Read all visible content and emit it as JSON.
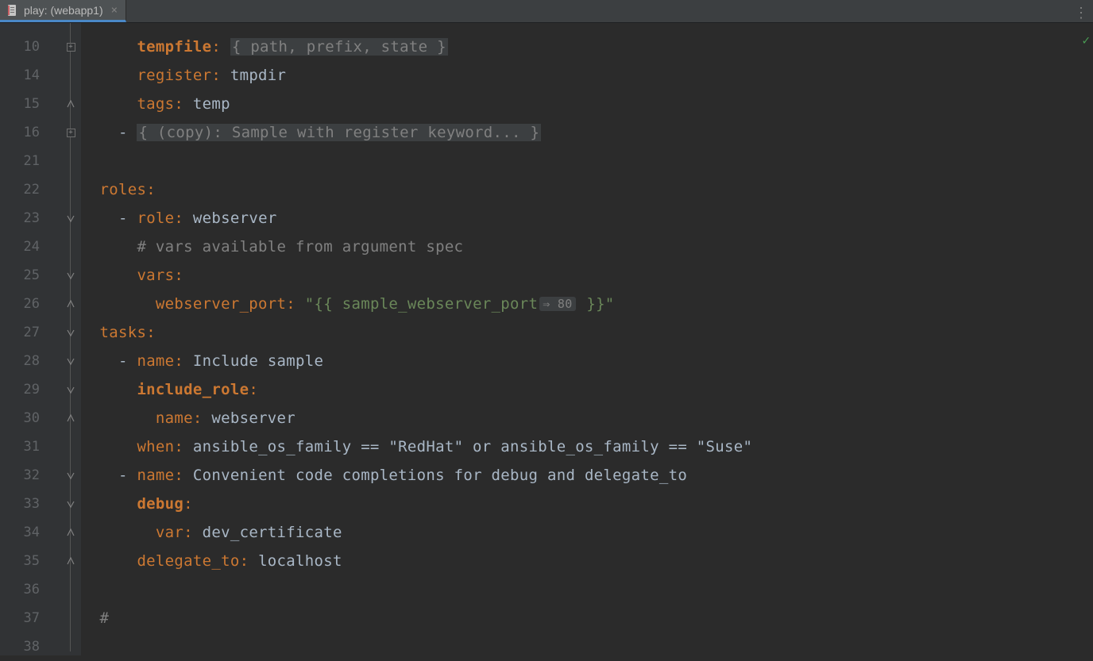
{
  "tab": {
    "title": "play: (webapp1)",
    "close_glyph": "×"
  },
  "more_glyph": "⋮",
  "check_glyph": "✓",
  "gutter": [
    "10",
    "14",
    "15",
    "16",
    "21",
    "22",
    "23",
    "24",
    "25",
    "26",
    "27",
    "28",
    "29",
    "30",
    "31",
    "32",
    "33",
    "34",
    "35",
    "36",
    "37",
    "38"
  ],
  "lines": {
    "l10": {
      "indent": "      ",
      "key": "tempfile",
      "fold": "{ path, prefix, state }"
    },
    "l14": {
      "indent": "      ",
      "key": "register",
      "val": "tmpdir"
    },
    "l15": {
      "indent": "      ",
      "key": "tags",
      "val": "temp"
    },
    "l16": {
      "indent": "    ",
      "dash": "- ",
      "fold": "{ (copy): Sample with register keyword... }"
    },
    "l22": {
      "indent": "  ",
      "key": "roles"
    },
    "l23": {
      "indent": "    ",
      "dash": "- ",
      "key": "role",
      "val": "webserver"
    },
    "l24": {
      "indent": "      ",
      "comment": "# vars available from argument spec"
    },
    "l25": {
      "indent": "      ",
      "key": "vars"
    },
    "l26": {
      "indent": "        ",
      "key": "webserver_port",
      "str_open": "\"{{ ",
      "var": "sample_webserver_port",
      "hint": "⇒ 80",
      "str_close": " }}\""
    },
    "l27": {
      "indent": "  ",
      "key": "tasks"
    },
    "l28": {
      "indent": "    ",
      "dash": "- ",
      "key": "name",
      "val": "Include sample"
    },
    "l29": {
      "indent": "      ",
      "keybold": "include_role"
    },
    "l30": {
      "indent": "        ",
      "key": "name",
      "val": "webserver"
    },
    "l31": {
      "indent": "      ",
      "key": "when",
      "val": "ansible_os_family == \"RedHat\" or ansible_os_family == \"Suse\""
    },
    "l32": {
      "indent": "    ",
      "dash": "- ",
      "key": "name",
      "val": "Convenient code completions for debug and delegate_to"
    },
    "l33": {
      "indent": "      ",
      "keybold": "debug"
    },
    "l34": {
      "indent": "        ",
      "key": "var",
      "val": "dev_certificate"
    },
    "l35": {
      "indent": "      ",
      "key": "delegate_to",
      "val": "localhost"
    },
    "l37": {
      "indent": "  ",
      "comment": "#"
    }
  },
  "fold_marks": {
    "0": "plus",
    "2": "end",
    "3": "plus",
    "6": "open",
    "7": "pass",
    "8": "open",
    "9": "end",
    "10": "open",
    "11": "open",
    "12": "open",
    "13": "end",
    "14": "pass",
    "15": "open",
    "16": "open",
    "17": "end",
    "18": "end"
  }
}
